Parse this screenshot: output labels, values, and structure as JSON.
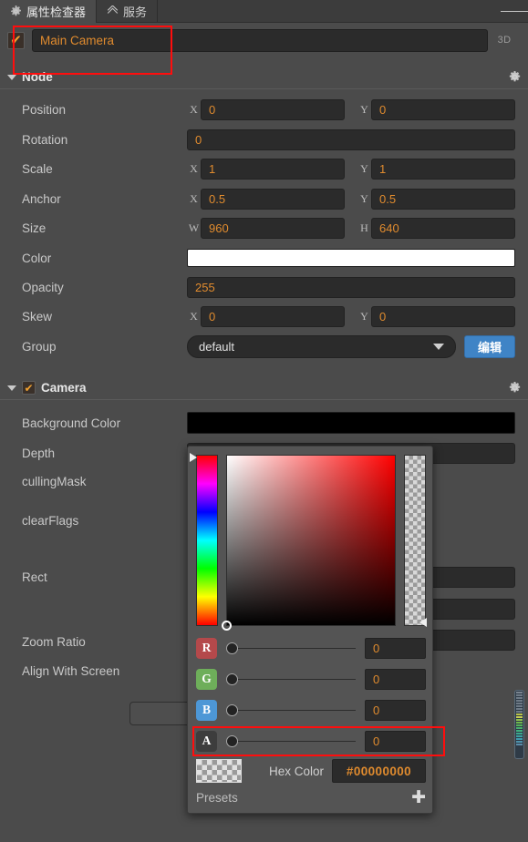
{
  "tabs": [
    {
      "label": "属性检查器",
      "icon": "gear-icon",
      "active": true
    },
    {
      "label": "服务",
      "icon": "link-icon",
      "active": false
    }
  ],
  "menu_icon": "hamburger-icon",
  "node": {
    "enabled_checkmark": "✔",
    "name": "Main Camera",
    "mode_badge": "3D",
    "section_title": "Node",
    "section_gear": "gear-icon",
    "properties": [
      {
        "label": "Position",
        "fields": [
          {
            "axis": "X",
            "value": "0"
          },
          {
            "axis": "Y",
            "value": "0"
          }
        ]
      },
      {
        "label": "Rotation",
        "fields": [
          {
            "axis": "",
            "value": "0"
          }
        ]
      },
      {
        "label": "Scale",
        "fields": [
          {
            "axis": "X",
            "value": "1"
          },
          {
            "axis": "Y",
            "value": "1"
          }
        ]
      },
      {
        "label": "Anchor",
        "fields": [
          {
            "axis": "X",
            "value": "0.5"
          },
          {
            "axis": "Y",
            "value": "0.5"
          }
        ]
      },
      {
        "label": "Size",
        "fields": [
          {
            "axis": "W",
            "value": "960"
          },
          {
            "axis": "H",
            "value": "640"
          }
        ]
      },
      {
        "label": "Color",
        "swatch": "#ffffff"
      },
      {
        "label": "Opacity",
        "fields": [
          {
            "axis": "",
            "value": "255"
          }
        ]
      },
      {
        "label": "Skew",
        "fields": [
          {
            "axis": "X",
            "value": "0"
          },
          {
            "axis": "Y",
            "value": "0"
          }
        ]
      },
      {
        "label": "Group",
        "select_value": "default",
        "edit_button": "编辑"
      }
    ]
  },
  "camera": {
    "enabled_checkmark": "✔",
    "section_title": "Camera",
    "section_gear": "gear-icon",
    "labels": {
      "background_color": "Background Color",
      "depth": "Depth",
      "culling_mask": "cullingMask",
      "clear_flags": "clearFlags",
      "rect": "Rect",
      "zoom_ratio": "Zoom Ratio",
      "align_with_screen": "Align With Screen"
    },
    "background_color_swatch": "#000000"
  },
  "color_picker": {
    "hue_marker_position": "top",
    "sv_marker_position": "bottom-left",
    "alpha_marker_position": "bottom",
    "channels": [
      {
        "name": "R",
        "badge_color": "#b4494b",
        "value": "0",
        "slider_pos": 0
      },
      {
        "name": "G",
        "badge_color": "#6eae5a",
        "value": "0",
        "slider_pos": 0
      },
      {
        "name": "B",
        "badge_color": "#4d97d6",
        "value": "0",
        "slider_pos": 0
      },
      {
        "name": "A",
        "badge_color": "#3d3d3d",
        "value": "0",
        "slider_pos": 0
      }
    ],
    "hex_label": "Hex Color",
    "hex_value": "#00000000",
    "presets_label": "Presets",
    "add_preset": "✚"
  },
  "annotations": {
    "accent_red": "#ff0d0d",
    "boxes": [
      {
        "name": "node-name-highlight"
      },
      {
        "name": "alpha-channel-highlight"
      }
    ]
  }
}
